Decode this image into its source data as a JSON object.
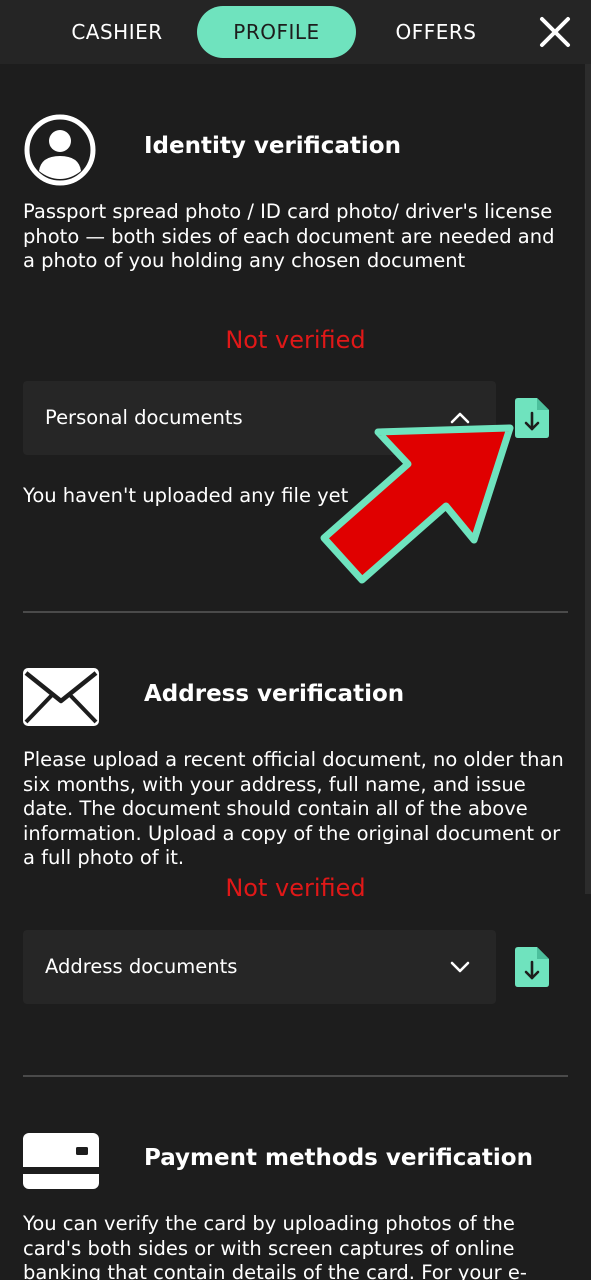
{
  "nav": {
    "tabs": [
      "CASHIER",
      "PROFILE",
      "OFFERS"
    ],
    "active_tab": "PROFILE",
    "close_icon": "close-icon"
  },
  "colors": {
    "accent": "#6fe3be",
    "status_error": "#e01818",
    "background": "#1d1d1d",
    "panel": "#262626"
  },
  "sections": {
    "identity": {
      "icon": "user-circle-icon",
      "title": "Identity verification",
      "description": "Passport spread photo / ID card photo/ driver's license photo — both sides of each document are needed and a photo of you holding any chosen document",
      "status": "Not verified",
      "dropdown_label": "Personal documents",
      "dropdown_icon": "chevron-up-icon",
      "upload_icon": "file-download-icon",
      "empty_note": "You haven't uploaded any file yet"
    },
    "address": {
      "icon": "envelope-icon",
      "title": "Address verification",
      "description": "Please upload a recent official document, no older than six months, with your address, full name, and issue date. The document should contain all of the above information. Upload a copy of the original document or a full photo of it.",
      "status": "Not verified",
      "dropdown_label": "Address documents",
      "dropdown_icon": "chevron-down-icon",
      "upload_icon": "file-download-icon"
    },
    "payment": {
      "icon": "credit-card-icon",
      "title": "Payment methods verification",
      "description": "You can verify the card by uploading photos of the card's both sides or with screen captures of online banking that contain details of the card. For your e-"
    }
  },
  "overlay": {
    "icon": "red-pointer-arrow-icon"
  }
}
